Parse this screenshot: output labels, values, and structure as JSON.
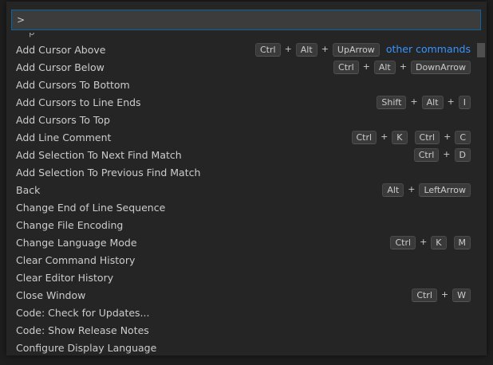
{
  "input": {
    "value": ">"
  },
  "commands": [
    {
      "label": "Add Cursor Above",
      "chords": [
        [
          "Ctrl",
          "Alt",
          "UpArrow"
        ]
      ],
      "other": "other commands"
    },
    {
      "label": "Add Cursor Below",
      "chords": [
        [
          "Ctrl",
          "Alt",
          "DownArrow"
        ]
      ]
    },
    {
      "label": "Add Cursors To Bottom",
      "chords": []
    },
    {
      "label": "Add Cursors to Line Ends",
      "chords": [
        [
          "Shift",
          "Alt",
          "I"
        ]
      ]
    },
    {
      "label": "Add Cursors To Top",
      "chords": []
    },
    {
      "label": "Add Line Comment",
      "chords": [
        [
          "Ctrl",
          "K"
        ],
        [
          "Ctrl",
          "C"
        ]
      ]
    },
    {
      "label": "Add Selection To Next Find Match",
      "chords": [
        [
          "Ctrl",
          "D"
        ]
      ]
    },
    {
      "label": "Add Selection To Previous Find Match",
      "chords": []
    },
    {
      "label": "Back",
      "chords": [
        [
          "Alt",
          "LeftArrow"
        ]
      ]
    },
    {
      "label": "Change End of Line Sequence",
      "chords": []
    },
    {
      "label": "Change File Encoding",
      "chords": []
    },
    {
      "label": "Change Language Mode",
      "chords": [
        [
          "Ctrl",
          "K"
        ],
        [
          "M"
        ]
      ]
    },
    {
      "label": "Clear Command History",
      "chords": []
    },
    {
      "label": "Clear Editor History",
      "chords": []
    },
    {
      "label": "Close Window",
      "chords": [
        [
          "Ctrl",
          "W"
        ]
      ]
    },
    {
      "label": "Code: Check for Updates...",
      "chords": []
    },
    {
      "label": "Code: Show Release Notes",
      "chords": []
    },
    {
      "label": "Configure Display Language",
      "chords": []
    }
  ],
  "colors": {
    "accent_link": "#3794ff",
    "focus_border": "#0e639c",
    "panel_bg": "#252526"
  }
}
